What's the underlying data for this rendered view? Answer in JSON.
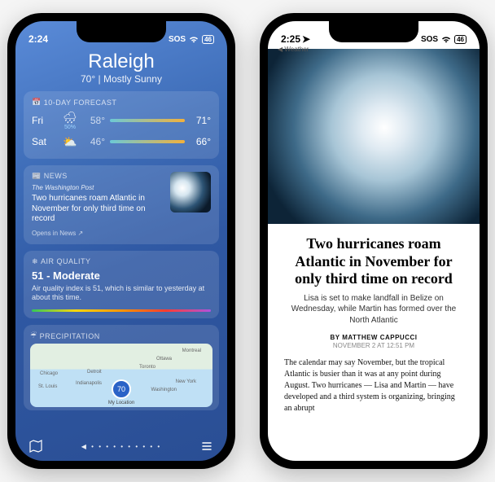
{
  "left": {
    "status": {
      "time": "2:24",
      "carrier": "SOS",
      "battery": "46"
    },
    "location": {
      "name": "Raleigh",
      "temp": "70°",
      "cond": "Mostly Sunny"
    },
    "forecast": {
      "header": "10-DAY FORECAST",
      "rows": [
        {
          "day": "Fri",
          "pct": "50%",
          "lo": "58°",
          "hi": "71°"
        },
        {
          "day": "Sat",
          "pct": "",
          "lo": "46°",
          "hi": "66°"
        }
      ]
    },
    "news": {
      "header": "NEWS",
      "source": "The Washington Post",
      "title": "Two hurricanes roam Atlantic in November for only third time on record",
      "open": "Opens in News ↗"
    },
    "aq": {
      "header": "AIR QUALITY",
      "value": "51 - Moderate",
      "detail": "Air quality index is 51, which is similar to yesterday at about this time."
    },
    "precip": {
      "header": "PRECIPITATION",
      "cities": [
        "Montreal",
        "Ottawa",
        "Toronto",
        "Chicago",
        "Detroit",
        "Indianapolis",
        "New York",
        "St. Louis",
        "Washington"
      ],
      "pin": "70",
      "legend": "My Location"
    },
    "nav": {
      "dots": "◀ • • • • • • • • • •"
    }
  },
  "right": {
    "status": {
      "time": "2:25",
      "carrier": "SOS",
      "battery": "46"
    },
    "back": "◀ Weather",
    "headline": "Two hurricanes roam Atlantic in November for only third time on record",
    "subhead": "Lisa is set to make landfall in Belize on Wednesday, while Martin has formed over the North Atlantic",
    "byline": "BY MATTHEW CAPPUCCI",
    "date": "NOVEMBER 2 AT 12:51 PM",
    "body": "The calendar may say November, but the tropical Atlantic is busier than it was at any point during August. Two hurricanes — Lisa and Martin — have developed and a third system is organizing, bringing an abrupt"
  }
}
